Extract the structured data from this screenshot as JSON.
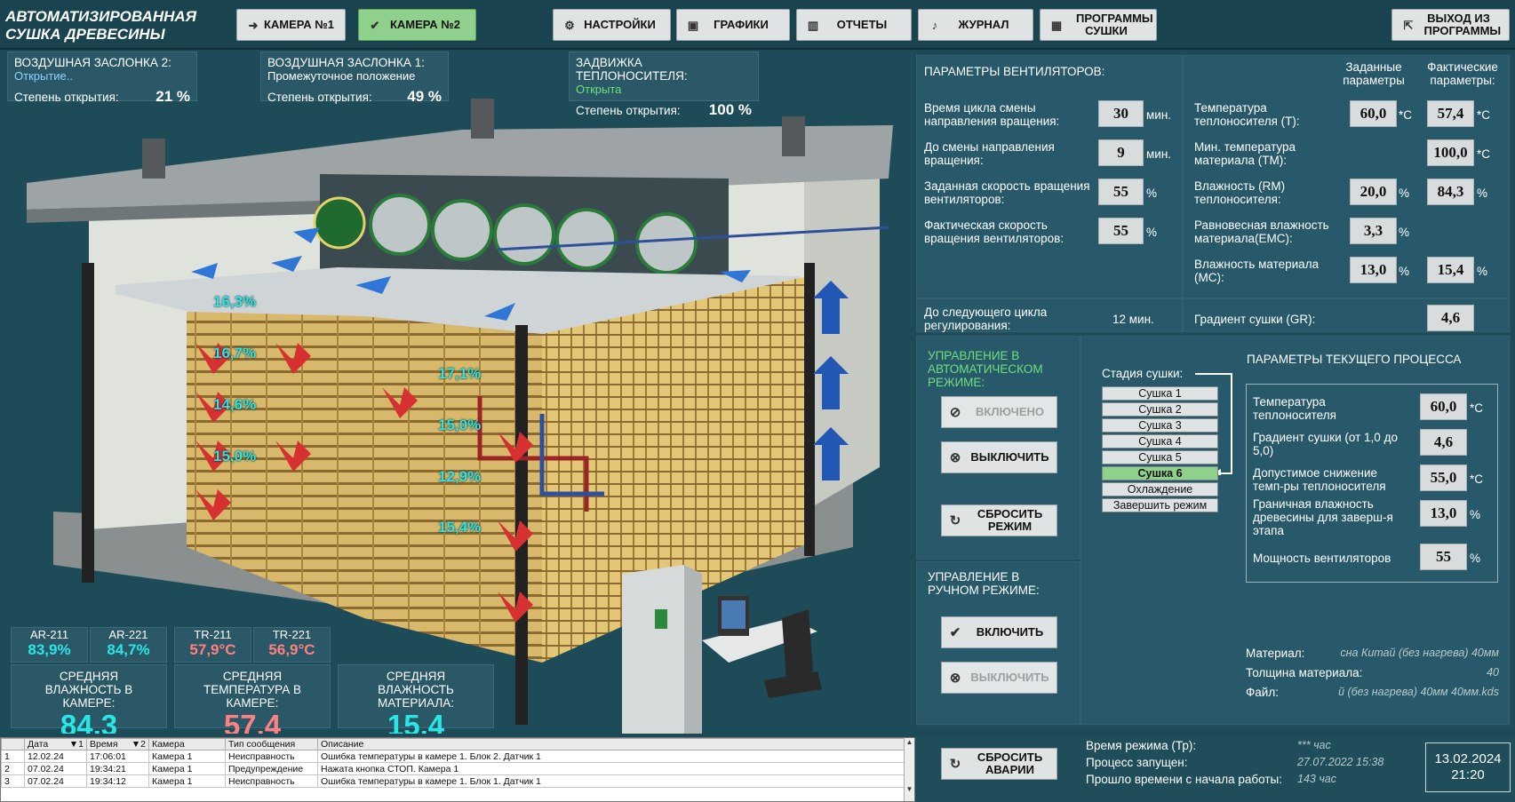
{
  "app": {
    "title": "АВТОМАТИЗИРОВАННАЯ СУШКА ДРЕВЕСИНЫ"
  },
  "toolbar": {
    "cam1": "КАМЕРА №1",
    "cam2": "КАМЕРА №2",
    "settings": "НАСТРОЙКИ",
    "charts": "ГРАФИКИ",
    "reports": "ОТЧЕТЫ",
    "journal": "ЖУРНАЛ",
    "programs": "ПРОГРАММЫ СУШКИ",
    "exit": "ВЫХОД ИЗ ПРОГРАММЫ"
  },
  "dampers": {
    "d2": {
      "title": "ВОЗДУШНАЯ ЗАСЛОНКА 2:",
      "state": "Открытие..",
      "deg_label": "Степень открытия:",
      "deg": "21 %",
      "state_color": "#8fd0ff"
    },
    "d1": {
      "title": "ВОЗДУШНАЯ ЗАСЛОНКА 1:",
      "state": "Промежуточное положение",
      "deg_label": "Степень открытия:",
      "deg": "49 %",
      "state_color": "#ffffff"
    },
    "valve": {
      "title": "ЗАДВИЖКА ТЕПЛОНОСИТЕЛЯ:",
      "state": "Открыта",
      "deg_label": "Степень открытия:",
      "deg": "100 %",
      "state_color": "#6fe07a"
    }
  },
  "moisture_points": [
    "16,3%",
    "16,7%",
    "14,6%",
    "15,0%",
    "17,1%",
    "15,0%",
    "12,9%",
    "15,4%"
  ],
  "sensors": [
    {
      "name": "AR-211",
      "value": "83,9%",
      "color": "#29e6e6"
    },
    {
      "name": "AR-221",
      "value": "84,7%",
      "color": "#29e6e6"
    },
    {
      "name": "TR-211",
      "value": "57,9°C",
      "color": "#ff8080"
    },
    {
      "name": "TR-221",
      "value": "56,9°C",
      "color": "#ff8080"
    }
  ],
  "averages": {
    "hum_label": "СРЕДНЯЯ ВЛАЖНОСТЬ В КАМЕРЕ:",
    "hum": "84,3",
    "temp_label": "СРЕДНЯЯ ТЕМПЕРАТУРА В КАМЕРЕ:",
    "temp": "57,4",
    "mat_label": "СРЕДНЯЯ ВЛАЖНОСТЬ МАТЕРИАЛА:",
    "mat": "15,4"
  },
  "fans": {
    "header": "ПАРАМЕТРЫ ВЕНТИЛЯТОРОВ:",
    "rows": [
      {
        "label": "Время цикла смены направления вращения:",
        "value": "30",
        "unit": "мин."
      },
      {
        "label": "До смены направления вращения:",
        "value": "9",
        "unit": "мин."
      },
      {
        "label": "Заданная скорость вращения вентиляторов:",
        "value": "55",
        "unit": "%"
      },
      {
        "label": "Фактическая скорость вращения вентиляторов:",
        "value": "55",
        "unit": "%"
      }
    ],
    "next_label": "До следующего цикла регулирования:",
    "next_value": "12 мин."
  },
  "params": {
    "set_header": "Заданные параметры",
    "actual_header": "Фактические параметры:",
    "rows": [
      {
        "label": "Температура теплоносителя (T):",
        "set": "60,0",
        "actual": "57,4",
        "unit": "*C"
      },
      {
        "label": "Мин. температура материала (TM):",
        "set": "",
        "actual": "100,0",
        "unit": "*C"
      },
      {
        "label": "Влажность (RM) теплоносителя:",
        "set": "20,0",
        "actual": "84,3",
        "unit": "%"
      },
      {
        "label": "Равновесная влажность материала(EMC):",
        "set": "3,3",
        "actual": "",
        "unit": "%"
      },
      {
        "label": "Влажность материала (MC):",
        "set": "13,0",
        "actual": "15,4",
        "unit": "%"
      }
    ],
    "gradient_label": "Градиент сушки (GR):",
    "gradient": "4,6"
  },
  "auto": {
    "title": "УПРАВЛЕНИЕ В АВТОМАТИЧЕСКОМ РЕЖИМЕ:",
    "on": "ВКЛЮЧЕНО",
    "off": "ВЫКЛЮЧИТЬ",
    "reset": "СБРОСИТЬ РЕЖИМ"
  },
  "manual": {
    "title": "УПРАВЛЕНИЕ В РУЧНОМ РЕЖИМЕ:",
    "on": "ВКЛЮЧИТЬ",
    "off": "ВЫКЛЮЧИТЬ"
  },
  "stages": {
    "label": "Стадия сушки:",
    "items": [
      "Сушка 1",
      "Сушка 2",
      "Сушка 3",
      "Сушка 4",
      "Сушка 5",
      "Сушка 6",
      "Охлаждение",
      "Завершить режим"
    ],
    "selected": "Сушка 6"
  },
  "process": {
    "header": "ПАРАМЕТРЫ ТЕКУЩЕГО ПРОЦЕССА",
    "rows": [
      {
        "label": "Температура теплоносителя",
        "value": "60,0",
        "unit": "*C"
      },
      {
        "label": "Градиент сушки (от 1,0 до 5,0)",
        "value": "4,6",
        "unit": ""
      },
      {
        "label": "Допустимое снижение темп-ры теплоносителя",
        "value": "55,0",
        "unit": "*C"
      },
      {
        "label": "Граничная влажность древесины для заверш-я этапа",
        "value": "13,0",
        "unit": "%"
      },
      {
        "label": "Мощность вентиляторов",
        "value": "55",
        "unit": "%"
      }
    ]
  },
  "material": {
    "mat_label": "Материал:",
    "mat": "сна Китай (без нагрева) 40мм",
    "thick_label": "Толщина материала:",
    "thick": "40",
    "file_label": "Файл:",
    "file": "й (без нагрева) 40мм 40мм.kds"
  },
  "log": {
    "columns": [
      "",
      "Дата",
      "Время",
      "Камера",
      "Тип сообщения",
      "Описание"
    ],
    "rows": [
      [
        "1",
        "12.02.24",
        "17:06:01",
        "Камера 1",
        "Неисправность",
        "Ошибка температуры в камере 1. Блок 2. Датчик 1"
      ],
      [
        "2",
        "07.02.24",
        "19:34:21",
        "Камера 1",
        "Предупреждение",
        "Нажата кнопка СТОП. Камера 1"
      ],
      [
        "3",
        "07.02.24",
        "19:34:12",
        "Камера 1",
        "Неисправность",
        "Ошибка температуры в камере 1. Блок 1. Датчик 1"
      ]
    ]
  },
  "status": {
    "reset_alarm": "СБРОСИТЬ АВАРИИ",
    "mode_time_label": "Время режима (Тр):",
    "mode_time": "*** час",
    "started_label": "Процесс запущен:",
    "started": "27.07.2022  15:38",
    "elapsed_label": "Прошло времени с начала работы:",
    "elapsed": "143  час",
    "date": "13.02.2024",
    "time": "21:20"
  }
}
